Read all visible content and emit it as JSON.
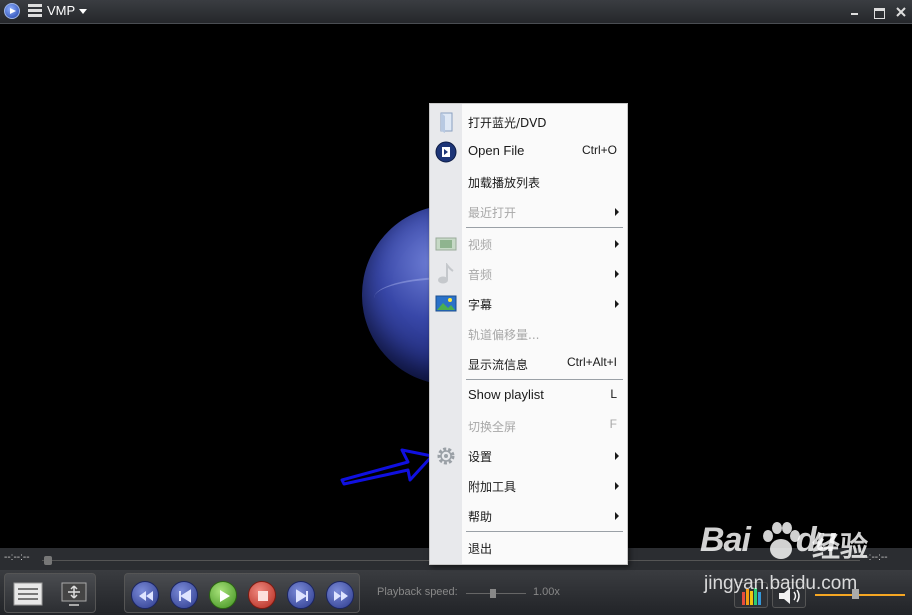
{
  "window": {
    "title": "VMP"
  },
  "player": {
    "time_elapsed": "--:--:--",
    "time_remaining": "--:--:--",
    "playback_speed_label": "Playback speed:",
    "playback_speed_value": "1.00x",
    "volume_level": 0.45
  },
  "context_menu": {
    "items": [
      {
        "label": "打开蓝光/DVD",
        "icon": "folder-disc-icon"
      },
      {
        "label": "Open File",
        "shortcut": "Ctrl+O",
        "icon": "open-file-icon"
      },
      {
        "label": "加载播放列表"
      },
      {
        "label": "最近打开",
        "disabled": true,
        "submenu": true
      },
      {
        "label": "视频",
        "disabled": true,
        "submenu": true,
        "icon": "film-icon"
      },
      {
        "label": "音频",
        "disabled": true,
        "submenu": true,
        "icon": "music-note-icon"
      },
      {
        "label": "字幕",
        "submenu": true,
        "icon": "subtitle-image-icon"
      },
      {
        "label": "轨道偏移量...",
        "disabled": true
      },
      {
        "label": "显示流信息",
        "shortcut": "Ctrl+Alt+I"
      },
      {
        "label": "Show playlist",
        "shortcut": "L"
      },
      {
        "label": "切换全屏",
        "shortcut": "F",
        "disabled": true
      },
      {
        "label": "设置",
        "submenu": true,
        "icon": "gear-icon"
      },
      {
        "label": "附加工具",
        "submenu": true
      },
      {
        "label": "帮助",
        "submenu": true
      },
      {
        "label": "退出"
      }
    ]
  },
  "watermark": {
    "brand": "Bai",
    "brand_suffix": "du",
    "cn": "经验",
    "url": "jingyan.baidu.com"
  },
  "colors": {
    "annotation_arrow": "#1010e0",
    "menu_background": "#fafafa",
    "disabled_text": "#a8a8a8",
    "volume_fill": "#f5a623"
  }
}
